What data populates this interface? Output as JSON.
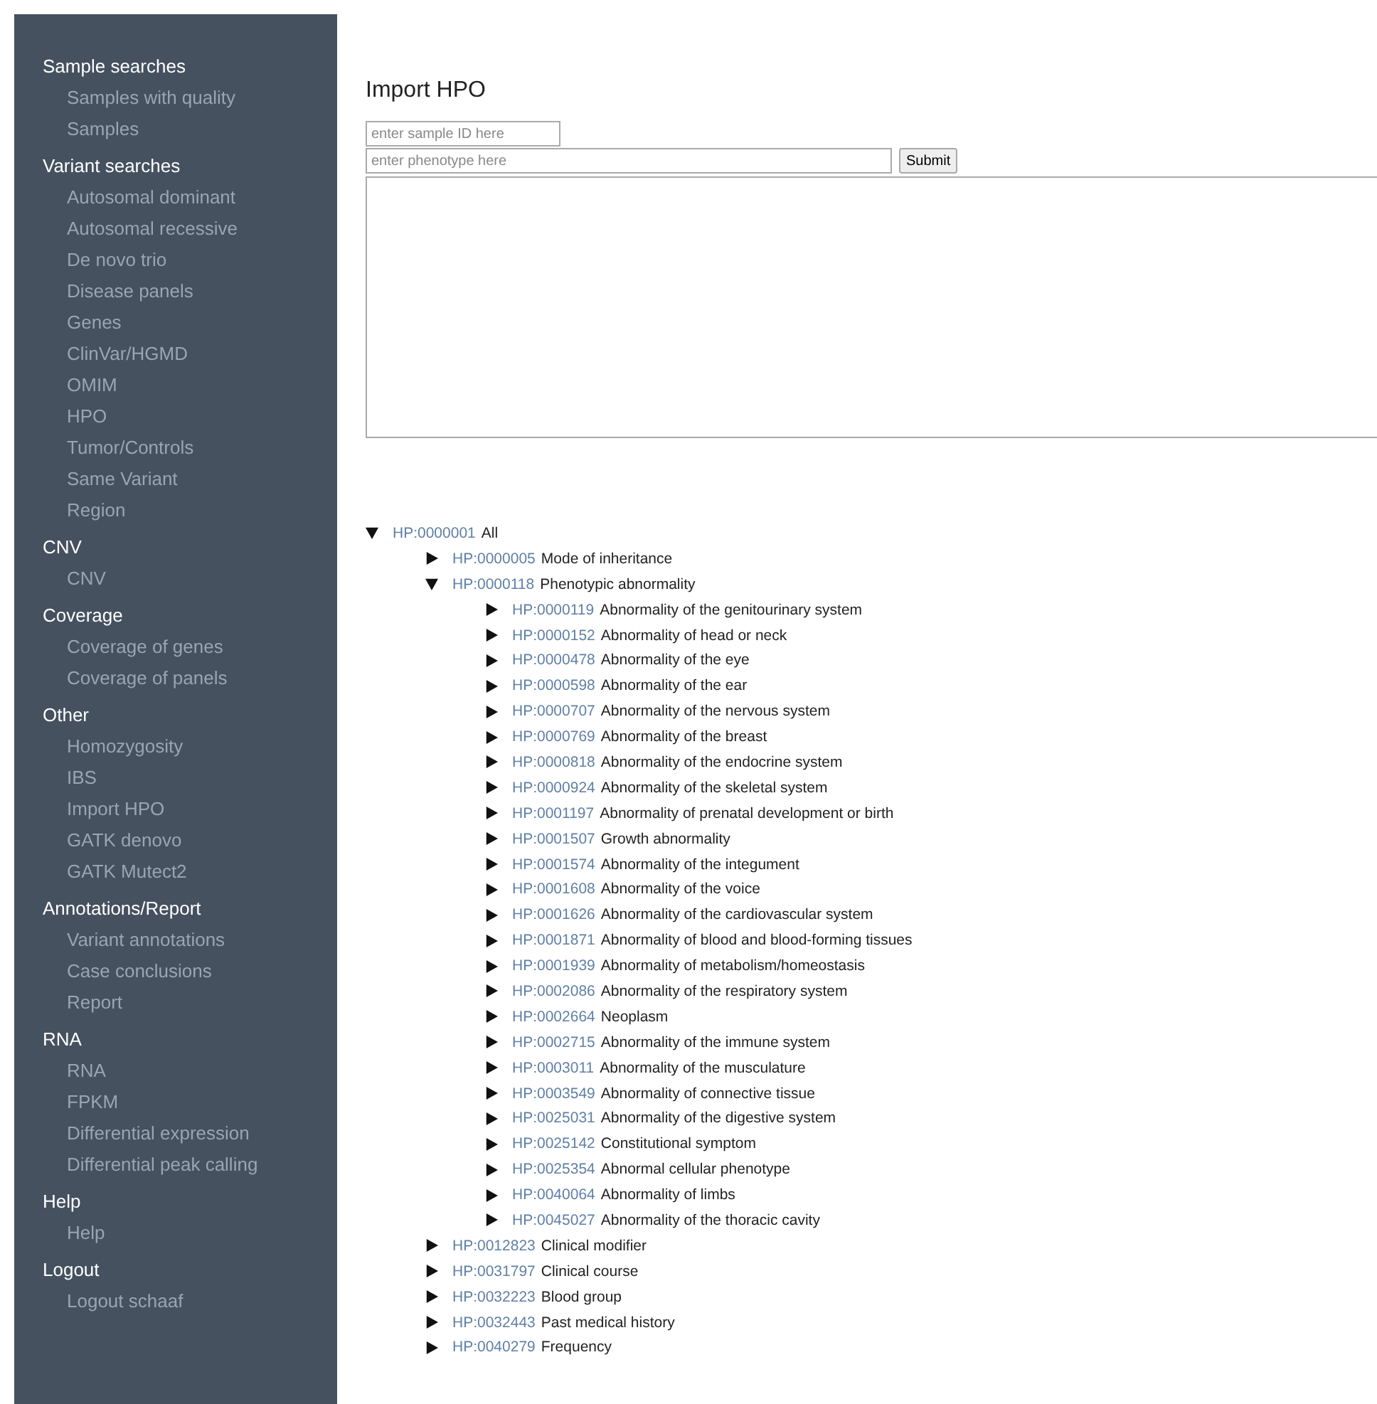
{
  "sidebar": {
    "sections": [
      {
        "heading": "Sample searches",
        "items": [
          "Samples with quality",
          "Samples"
        ]
      },
      {
        "heading": "Variant searches",
        "items": [
          "Autosomal dominant",
          "Autosomal recessive",
          "De novo trio",
          "Disease panels",
          "Genes",
          "ClinVar/HGMD",
          "OMIM",
          "HPO",
          "Tumor/Controls",
          "Same Variant",
          "Region"
        ]
      },
      {
        "heading": "CNV",
        "items": [
          "CNV"
        ]
      },
      {
        "heading": "Coverage",
        "items": [
          "Coverage of genes",
          "Coverage of panels"
        ]
      },
      {
        "heading": "Other",
        "items": [
          "Homozygosity",
          "IBS",
          "Import HPO",
          "GATK denovo",
          "GATK Mutect2"
        ]
      },
      {
        "heading": "Annotations/Report",
        "items": [
          "Variant annotations",
          "Case conclusions",
          "Report"
        ]
      },
      {
        "heading": "RNA",
        "items": [
          "RNA",
          "FPKM",
          "Differential expression",
          "Differential peak calling"
        ]
      },
      {
        "heading": "Help",
        "items": [
          "Help"
        ]
      },
      {
        "heading": "Logout",
        "items": [
          "Logout schaaf"
        ]
      }
    ]
  },
  "page": {
    "title": "Import HPO",
    "sample_field": {
      "placeholder": "enter sample ID here"
    },
    "phenotype_field": {
      "placeholder": "enter phenotype here"
    },
    "submit": "Submit"
  },
  "tree": [
    {
      "id": "HP:0000001",
      "label": "All",
      "expanded": true,
      "children": [
        {
          "id": "HP:0000005",
          "label": "Mode of inheritance",
          "expanded": false
        },
        {
          "id": "HP:0000118",
          "label": "Phenotypic abnormality",
          "expanded": true,
          "children": [
            {
              "id": "HP:0000119",
              "label": "Abnormality of the genitourinary system",
              "expanded": false
            },
            {
              "id": "HP:0000152",
              "label": "Abnormality of head or neck",
              "expanded": false
            },
            {
              "id": "HP:0000478",
              "label": "Abnormality of the eye",
              "expanded": false
            },
            {
              "id": "HP:0000598",
              "label": "Abnormality of the ear",
              "expanded": false
            },
            {
              "id": "HP:0000707",
              "label": "Abnormality of the nervous system",
              "expanded": false
            },
            {
              "id": "HP:0000769",
              "label": "Abnormality of the breast",
              "expanded": false
            },
            {
              "id": "HP:0000818",
              "label": "Abnormality of the endocrine system",
              "expanded": false
            },
            {
              "id": "HP:0000924",
              "label": "Abnormality of the skeletal system",
              "expanded": false
            },
            {
              "id": "HP:0001197",
              "label": "Abnormality of prenatal development or birth",
              "expanded": false
            },
            {
              "id": "HP:0001507",
              "label": "Growth abnormality",
              "expanded": false
            },
            {
              "id": "HP:0001574",
              "label": "Abnormality of the integument",
              "expanded": false
            },
            {
              "id": "HP:0001608",
              "label": "Abnormality of the voice",
              "expanded": false
            },
            {
              "id": "HP:0001626",
              "label": "Abnormality of the cardiovascular system",
              "expanded": false
            },
            {
              "id": "HP:0001871",
              "label": "Abnormality of blood and blood-forming tissues",
              "expanded": false
            },
            {
              "id": "HP:0001939",
              "label": "Abnormality of metabolism/homeostasis",
              "expanded": false
            },
            {
              "id": "HP:0002086",
              "label": "Abnormality of the respiratory system",
              "expanded": false
            },
            {
              "id": "HP:0002664",
              "label": "Neoplasm",
              "expanded": false
            },
            {
              "id": "HP:0002715",
              "label": "Abnormality of the immune system",
              "expanded": false
            },
            {
              "id": "HP:0003011",
              "label": "Abnormality of the musculature",
              "expanded": false
            },
            {
              "id": "HP:0003549",
              "label": "Abnormality of connective tissue",
              "expanded": false
            },
            {
              "id": "HP:0025031",
              "label": "Abnormality of the digestive system",
              "expanded": false
            },
            {
              "id": "HP:0025142",
              "label": "Constitutional symptom",
              "expanded": false
            },
            {
              "id": "HP:0025354",
              "label": "Abnormal cellular phenotype",
              "expanded": false
            },
            {
              "id": "HP:0040064",
              "label": "Abnormality of limbs",
              "expanded": false
            },
            {
              "id": "HP:0045027",
              "label": "Abnormality of the thoracic cavity",
              "expanded": false
            }
          ]
        },
        {
          "id": "HP:0012823",
          "label": "Clinical modifier",
          "expanded": false
        },
        {
          "id": "HP:0031797",
          "label": "Clinical course",
          "expanded": false
        },
        {
          "id": "HP:0032223",
          "label": "Blood group",
          "expanded": false
        },
        {
          "id": "HP:0032443",
          "label": "Past medical history",
          "expanded": false
        },
        {
          "id": "HP:0040279",
          "label": "Frequency",
          "expanded": false
        }
      ]
    }
  ]
}
